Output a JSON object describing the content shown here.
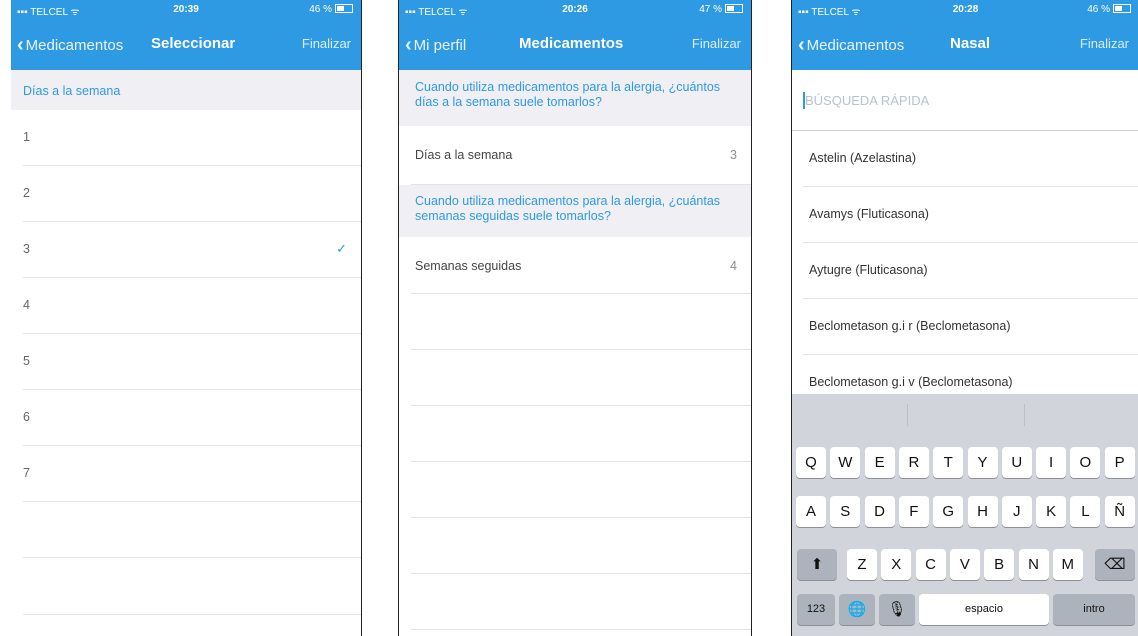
{
  "status": {
    "p1": {
      "carrier": "TELCEL",
      "time": "20:39",
      "battery": "46 %"
    },
    "p2": {
      "carrier": "TELCEL",
      "time": "20:26",
      "battery": "47 %"
    },
    "p3": {
      "carrier": "TELCEL",
      "time": "20:28",
      "battery": "46 %"
    }
  },
  "panel1": {
    "back_label": "Medicamentos",
    "title": "Seleccionar",
    "done_label": "Finalizar",
    "section_header": "Días a la semana",
    "options": [
      "1",
      "2",
      "3",
      "4",
      "5",
      "6",
      "7"
    ],
    "selected": "3",
    "check_icon": "checkmark-icon"
  },
  "panel2": {
    "back_label": "Mi perfil",
    "title": "Medicamentos",
    "done_label": "Finalizar",
    "question1": "Cuando utiliza medicamentos para la alergia, ¿cuántos días a la semana suele tomarlos?",
    "row1": {
      "label": "Días a la semana",
      "value": "3"
    },
    "question2": "Cuando utiliza medicamentos para la alergia, ¿cuántas semanas seguidas suele tomarlos?",
    "row2": {
      "label": "Semanas seguidas",
      "value": "4"
    }
  },
  "panel3": {
    "back_label": "Medicamentos",
    "title": "Nasal",
    "done_label": "Finalizar",
    "search_placeholder": "BÚSQUEDA RÁPIDA",
    "medications": [
      "Astelin (Azelastina)",
      "Avamys (Fluticasona)",
      "Aytugre (Fluticasona)",
      "Beclometason g.i r (Beclometasona)",
      "Beclometason g.i v (Beclometasona)"
    ]
  },
  "keyboard": {
    "row1": [
      "Q",
      "W",
      "E",
      "R",
      "T",
      "Y",
      "U",
      "I",
      "O",
      "P"
    ],
    "row2": [
      "A",
      "S",
      "D",
      "F",
      "G",
      "H",
      "J",
      "K",
      "L",
      "Ñ"
    ],
    "row3": [
      "Z",
      "X",
      "C",
      "V",
      "B",
      "N",
      "M"
    ],
    "shift_icon": "shift-icon",
    "delete_icon": "backspace-icon",
    "numbers_label": "123",
    "globe_icon": "globe-icon",
    "mic_icon": "microphone-icon",
    "space_label": "espacio",
    "return_label": "intro"
  },
  "colors": {
    "accent": "#2f9ae4",
    "section_bg": "#efeff4",
    "keyboard_bg": "#d1d4da"
  }
}
